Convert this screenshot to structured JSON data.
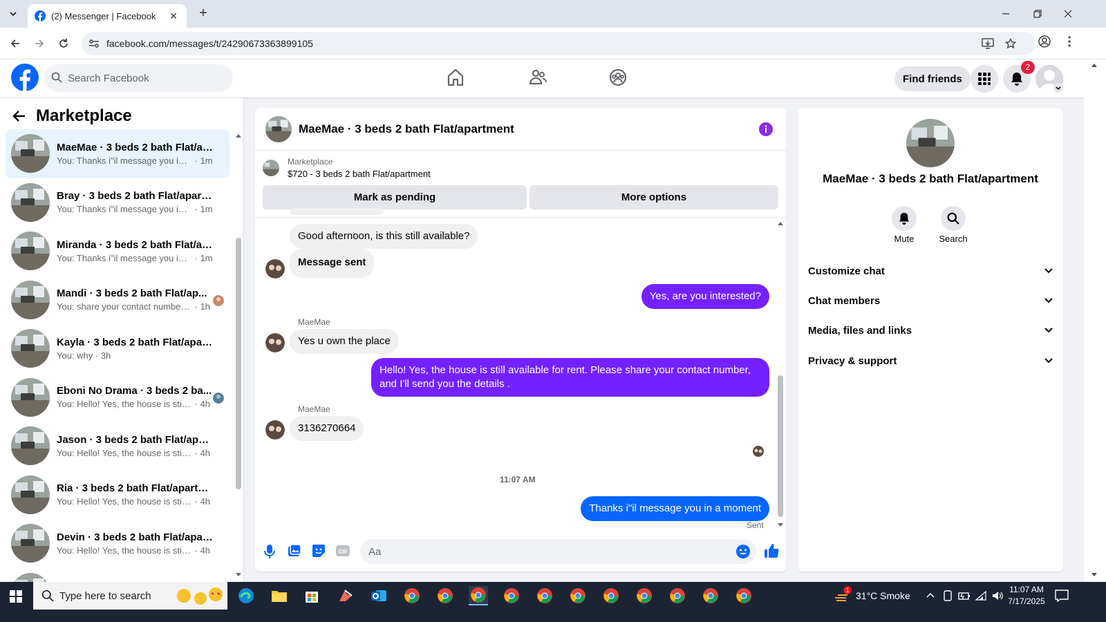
{
  "browser": {
    "tab_title": "(2) Messenger | Facebook",
    "url": "facebook.com/messages/t/24290673363899105"
  },
  "fb": {
    "search_placeholder": "Search Facebook",
    "find_friends": "Find friends",
    "notif_count": "2"
  },
  "left": {
    "title": "Marketplace",
    "conversations": [
      {
        "name": "MaeMae · 3 beds 2 bath Flat/ap...",
        "preview": "You: Thanks i\"il message you in a ...",
        "time": "· 1m"
      },
      {
        "name": "Bray · 3 beds 2 bath Flat/apartm...",
        "preview": "You: Thanks i\"il message you in a ...",
        "time": "· 1m"
      },
      {
        "name": "Miranda · 3 beds 2 bath Flat/apa...",
        "preview": "You: Thanks i\"il message you in a ...",
        "time": "· 1m"
      },
      {
        "name": "Mandi · 3 beds 2 bath Flat/ap...",
        "preview": "You: share your contact number,...",
        "time": "· 1h"
      },
      {
        "name": "Kayla · 3 beds 2 bath Flat/apart...",
        "preview": "You: why",
        "time": "· 3h"
      },
      {
        "name": "Eboni No Drama · 3 beds 2 ba...",
        "preview": "You: Hello! Yes, the house is still ...",
        "time": "· 4h"
      },
      {
        "name": "Jason · 3 beds 2 bath Flat/apart...",
        "preview": "You: Hello! Yes, the house is still av...",
        "time": "· 4h"
      },
      {
        "name": "Ria · 3 beds 2 bath Flat/apartment",
        "preview": "You: Hello! Yes, the house is still av...",
        "time": "· 4h"
      },
      {
        "name": "Devin · 3 beds 2 bath Flat/apart...",
        "preview": "You: Hello! Yes, the house is still av...",
        "time": "· 4h"
      }
    ]
  },
  "chat": {
    "title": "MaeMae · 3 beds 2 bath Flat/apartment",
    "marketplace_label": "Marketplace",
    "listing": "$720 - 3 beds 2 bath Flat/apartment",
    "mark_pending": "Mark as pending",
    "more_options": "More options",
    "messages": {
      "m1": "Good afternoon, is this still available?",
      "m2": "Message sent",
      "m3": "Yes, are you interested?",
      "sender1": "MaeMae",
      "m4": "Yes u own the place",
      "m5": "Hello! Yes, the house is still available for rent. Please share your contact number, and I'll send you the details .",
      "sender2": "MaeMae",
      "m6": "3136270664",
      "timestamp": "11:07 AM",
      "m7": "Thanks i\"il message you in a moment",
      "status": "Sent"
    },
    "input_placeholder": "Aa"
  },
  "right": {
    "title": "MaeMae · 3 beds 2 bath Flat/apartment",
    "mute": "Mute",
    "search": "Search",
    "items": [
      "Customize chat",
      "Chat members",
      "Media, files and links",
      "Privacy & support"
    ]
  },
  "taskbar": {
    "search_placeholder": "Type here to search",
    "weather": "31°C  Smoke",
    "weather_alert": "1",
    "time": "11:07 AM",
    "date": "7/17/2025"
  },
  "colors": {
    "fb_blue": "#0866ff",
    "purple_bubble": "#7421ff",
    "active_row": "#e7f3ff"
  }
}
